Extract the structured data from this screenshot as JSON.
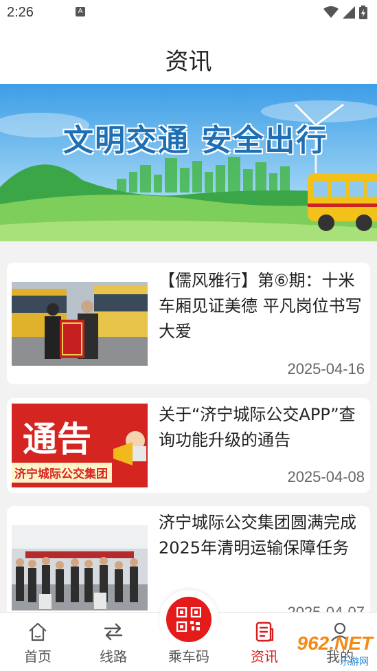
{
  "status_bar": {
    "time": "2:26",
    "notif_letter": "A"
  },
  "header": {
    "title": "资讯"
  },
  "banner": {
    "slogan": "文明交通 安全出行"
  },
  "news": [
    {
      "title": "【儒风雅行】第⑥期：十米车厢见证美德 平凡岗位书写大爱",
      "date": "2025-04-16",
      "thumb": "photo-banner-award"
    },
    {
      "title": "关于“济宁城际公交APP”查询功能升级的通告",
      "date": "2025-04-08",
      "thumb_title": "通告",
      "thumb_subtitle": "济宁城际公交集团"
    },
    {
      "title": "济宁城际公交集团圆满完成2025年清明运输保障任务",
      "date": "2025-04-07",
      "thumb": "photo-station-crowd"
    }
  ],
  "tabs": [
    {
      "label": "首页",
      "icon": "home-icon"
    },
    {
      "label": "线路",
      "icon": "route-icon"
    },
    {
      "label": "乘车码",
      "icon": "qr-code-icon"
    },
    {
      "label": "资讯",
      "icon": "news-icon",
      "active": true
    },
    {
      "label": "我的",
      "icon": "user-icon"
    }
  ],
  "watermark": {
    "text": "962.NET",
    "subtext": "乐游网"
  },
  "colors": {
    "accent": "#d81e1e",
    "banner_sky": "#5bb0e8",
    "bus_yellow": "#f2c21b"
  }
}
